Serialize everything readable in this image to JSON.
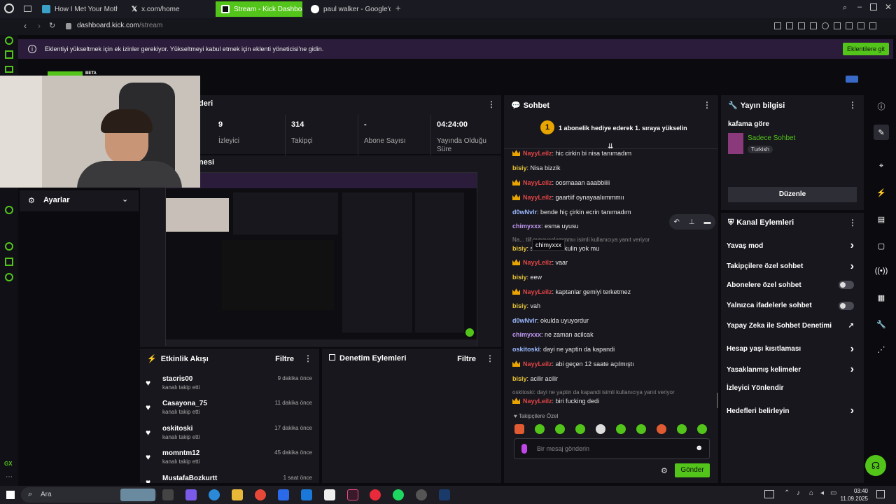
{
  "browser": {
    "tabs": [
      {
        "label": "How I Met Your Mother &"
      },
      {
        "label": "x.com/home"
      },
      {
        "label": "Stream - Kick Dashboard"
      },
      {
        "label": "paul walker - Google'da A"
      }
    ],
    "address": "dashboard.kick.com/stream",
    "address_host": "dashboard.kick.com",
    "address_path": "/stream"
  },
  "infobar": {
    "message": "Eklentiyi yükseltmek için ek izinler gerekiyor. Yükseltmeyi kabul etmek için eklenti yöneticisi'ne gidin.",
    "button": "Eklentilere git"
  },
  "logo": {
    "beta": "BETA"
  },
  "stream_panel": {
    "title_fragment": "deri",
    "preview_fragment": "nesi",
    "stats": [
      {
        "value": "9",
        "label": "İzleyici"
      },
      {
        "value": "314",
        "label": "Takipçi"
      },
      {
        "value": "-",
        "label": "Abone Sayısı"
      },
      {
        "value": "04:24:00",
        "label": "Yayında Olduğu Süre"
      }
    ]
  },
  "settings": {
    "label": "Ayarlar"
  },
  "activity": {
    "title": "Etkinlik Akışı",
    "filter": "Filtre",
    "events": [
      {
        "name": "stacris00",
        "sub": "kanalı takip etti",
        "time": "9 dakika önce"
      },
      {
        "name": "Casayona_75",
        "sub": "kanalı takip etti",
        "time": "11 dakika önce"
      },
      {
        "name": "oskitoski",
        "sub": "kanalı takip etti",
        "time": "17 dakika önce"
      },
      {
        "name": "momntm12",
        "sub": "kanalı takip etti",
        "time": "45 dakika önce"
      },
      {
        "name": "MustafaBozkurtt",
        "sub": "",
        "time": "1 saat önce"
      }
    ]
  },
  "moderation": {
    "title": "Denetim Eylemleri",
    "filter": "Filtre"
  },
  "chat": {
    "title": "Sohbet",
    "gift_banner": "1 abonelik hediye ederek 1. sıraya yükselin",
    "gift_rank": "1",
    "messages": [
      {
        "user": "NayyLeilz",
        "style": "red",
        "crown": true,
        "text": ": hic cirkin bi nisa tanımadım"
      },
      {
        "user": "bisiy",
        "style": "yel",
        "crown": false,
        "text": ": Nisa bizzik"
      },
      {
        "user": "NayyLeilz",
        "style": "red",
        "crown": true,
        "text": ": oosmaaan aaabbiiii"
      },
      {
        "user": "NayyLeilz",
        "style": "red",
        "crown": true,
        "text": ": gaartiif oynayaalıımmmıı"
      },
      {
        "user": "d0wNvlr",
        "style": "blue",
        "crown": false,
        "text": ": bende hiç çirkin ecrin tanımadım"
      },
      {
        "user": "chimyxxx",
        "style": "purp",
        "crown": false,
        "text": ": esma uyusu"
      },
      {
        "user": "bisiy",
        "style": "yel",
        "crown": false,
        "text": ": saat senin okulin yok mu"
      },
      {
        "user": "NayyLeilz",
        "style": "red",
        "crown": true,
        "text": ": vaar"
      },
      {
        "user": "bisiy",
        "style": "yel",
        "crown": false,
        "text": ": eew"
      },
      {
        "user": "NayyLeilz",
        "style": "red",
        "crown": true,
        "text": ": kaptanlar gemiyi terketmez"
      },
      {
        "user": "bisiy",
        "style": "yel",
        "crown": false,
        "text": ": vah"
      },
      {
        "user": "d0wNvlr",
        "style": "blue",
        "crown": false,
        "text": ": okulda uyuyordur"
      },
      {
        "user": "chimyxxx",
        "style": "purp",
        "crown": false,
        "text": ": ne zaman acilcak"
      },
      {
        "user": "oskitoski",
        "style": "blue",
        "crown": false,
        "text": ": dayi ne yaptin da kapandi"
      },
      {
        "user": "NayyLeilz",
        "style": "red",
        "crown": true,
        "text": ": abi geçen 12 saate açılmıştı"
      },
      {
        "user": "bisiy",
        "style": "yel",
        "crown": false,
        "text": ": acilir acilir"
      },
      {
        "user": "NayyLeilz",
        "style": "red",
        "crown": true,
        "text": ": biri fucking dedi"
      }
    ],
    "reply1": "Na... tiif oynayaalıımmmıı isimli kullanıcıya yanıt veriyor",
    "reply2": "oskitoski: dayi ne yaptin da kapandi isimli kullanıcıya yanıt veriyor",
    "tooltip": "chimyxxx",
    "followers_only": "Takipçilere Özel",
    "input_placeholder": "Bir mesaj gönderin",
    "send": "Gönder"
  },
  "stream_info": {
    "title": "Yayın bilgisi",
    "stream_title": "kafama göre",
    "category": "Sadece Sohbet",
    "language": "Turkish",
    "edit": "Düzenle"
  },
  "channel_actions": {
    "title": "Kanal Eylemleri",
    "items": [
      {
        "label": "Yavaş mod",
        "control": "arrow"
      },
      {
        "label": "Takipçilere özel sohbet",
        "control": "arrow"
      },
      {
        "label": "Abonelere özel sohbet",
        "control": "toggle"
      },
      {
        "label": "Yalnızca ifadelerle sohbet",
        "control": "toggle"
      },
      {
        "label": "Yapay Zeka ile Sohbet Denetimi",
        "control": "external"
      },
      {
        "label": "Hesap yaşı kısıtlaması",
        "control": "arrow"
      },
      {
        "label": "Yasaklanmış kelimeler",
        "control": "arrow"
      },
      {
        "label": "İzleyici Yönlendir",
        "control": "none"
      },
      {
        "label": "Hedefleri belirleyin",
        "control": "arrow"
      }
    ]
  },
  "taskbar": {
    "search": "Ara",
    "time": "03:40",
    "date": "11.09.2025"
  },
  "colors": {
    "accent": "#53c41a",
    "bg": "#0b0b0f",
    "panel": "#17171d"
  }
}
